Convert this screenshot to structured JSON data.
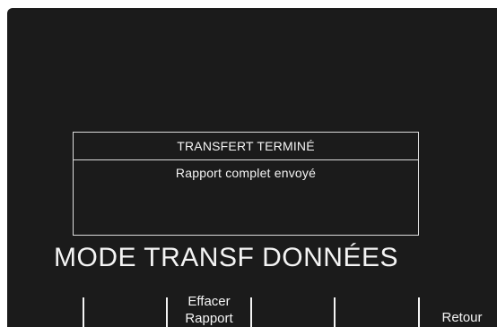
{
  "dialog": {
    "title": "TRANSFERT TERMINÉ",
    "message": "Rapport complet envoyé"
  },
  "mode": {
    "title": "MODE TRANSF DONNÉES"
  },
  "softkeys": {
    "clear_report_line1": "Effacer",
    "clear_report_line2": "Rapport",
    "back": "Retour"
  },
  "colors": {
    "screen_background": "#1b1b1b",
    "text": "#f4f4f4"
  }
}
